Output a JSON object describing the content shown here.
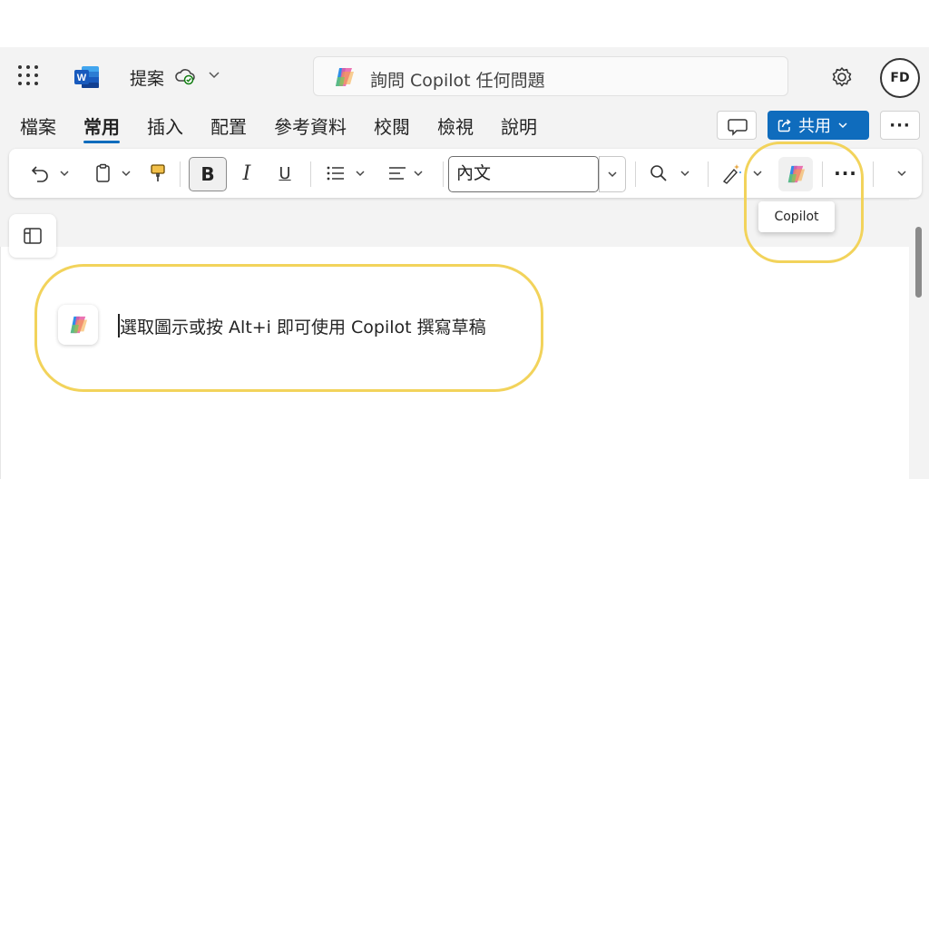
{
  "titlebar": {
    "document_title": "提案",
    "search_placeholder": "詢問 Copilot 任何問題",
    "avatar_initials": "FD"
  },
  "tabs": [
    {
      "label": "檔案",
      "active": false
    },
    {
      "label": "常用",
      "active": true
    },
    {
      "label": "插入",
      "active": false
    },
    {
      "label": "配置",
      "active": false
    },
    {
      "label": "參考資料",
      "active": false
    },
    {
      "label": "校閱",
      "active": false
    },
    {
      "label": "檢視",
      "active": false
    },
    {
      "label": "說明",
      "active": false
    }
  ],
  "actions": {
    "share_label": "共用",
    "more_label": "···"
  },
  "toolbar": {
    "bold_label": "B",
    "italic_label": "I",
    "underline_label": "U",
    "style_value": "內文",
    "more_label": "···",
    "copilot_tooltip": "Copilot"
  },
  "document": {
    "draft_hint": "選取圖示或按 Alt+i 即可使用 Copilot 撰寫草稿"
  },
  "colors": {
    "accent": "#0f6cbd",
    "highlight": "#f2d35b"
  }
}
